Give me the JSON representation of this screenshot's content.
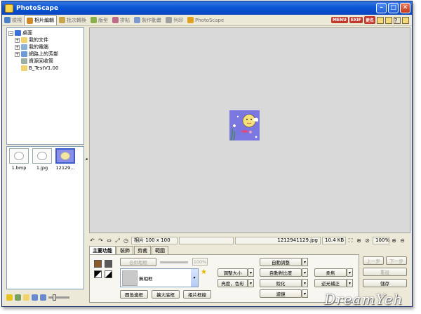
{
  "window": {
    "title": "PhotoScape"
  },
  "tabs": [
    {
      "label": "檢視",
      "color": "#4a80c8",
      "active": false
    },
    {
      "label": "相片編輯",
      "color": "#d08a2a",
      "active": true
    },
    {
      "label": "批次轉換",
      "color": "#c9a34a",
      "active": false
    },
    {
      "label": "版型",
      "color": "#8ab04a",
      "active": false
    },
    {
      "label": "拼貼",
      "color": "#c06a8a",
      "active": false
    },
    {
      "label": "製作動畫",
      "color": "#7a9ad0",
      "active": false
    },
    {
      "label": "列印",
      "color": "#a0a0a0",
      "active": false
    },
    {
      "label": "PhotoScape",
      "color": "#e0a020",
      "active": false
    }
  ],
  "top_right": {
    "menu_badge": "MENU",
    "exif_badge": "EXIF",
    "rename_badge": "更名"
  },
  "tree": [
    {
      "label": "桌面",
      "toggle": "−",
      "level": 0,
      "color": "#3a6ed8"
    },
    {
      "label": "我的文件",
      "toggle": "+",
      "level": 1,
      "color": "#f2d36b"
    },
    {
      "label": "我的電腦",
      "toggle": "+",
      "level": 1,
      "color": "#8ab0d8"
    },
    {
      "label": "網路上的芳鄰",
      "toggle": "+",
      "level": 1,
      "color": "#6a9ad8"
    },
    {
      "label": "資源回收筒",
      "toggle": "",
      "level": 1,
      "color": "#9ab0a0"
    },
    {
      "label": "B_TestV1.00",
      "toggle": "",
      "level": 1,
      "color": "#f2d36b"
    }
  ],
  "thumbnails": [
    {
      "caption": "1.bmp",
      "selected": false
    },
    {
      "caption": "1.jpg",
      "selected": false
    },
    {
      "caption": "12129...",
      "selected": true
    }
  ],
  "status": {
    "photo_size": "相片 100 x 100",
    "filename": "1212941129.jpg",
    "filesize": "10.4 KB",
    "zoom": "100%"
  },
  "control_tabs": [
    "主要功能",
    "裝飾",
    "剪裁",
    "範圍"
  ],
  "controls": {
    "merge_frame": "合併相框",
    "percent": "100%",
    "frame_select": "無相框",
    "round_corner": "圓角邊框",
    "expand_border": "擴大底框",
    "photo_border": "相片框線",
    "resize": "調整大小",
    "brightness_color": "亮度，色彩",
    "auto_level": "自動調整",
    "auto_contrast": "自動對比度",
    "sharpen": "銳化",
    "filter": "濾鏡",
    "soften": "柔焦",
    "backlight": "逆光補正",
    "undo": "上一步",
    "redo": "下一步",
    "restore": "重設",
    "save": "儲存"
  },
  "watermark": "DreamYeh"
}
